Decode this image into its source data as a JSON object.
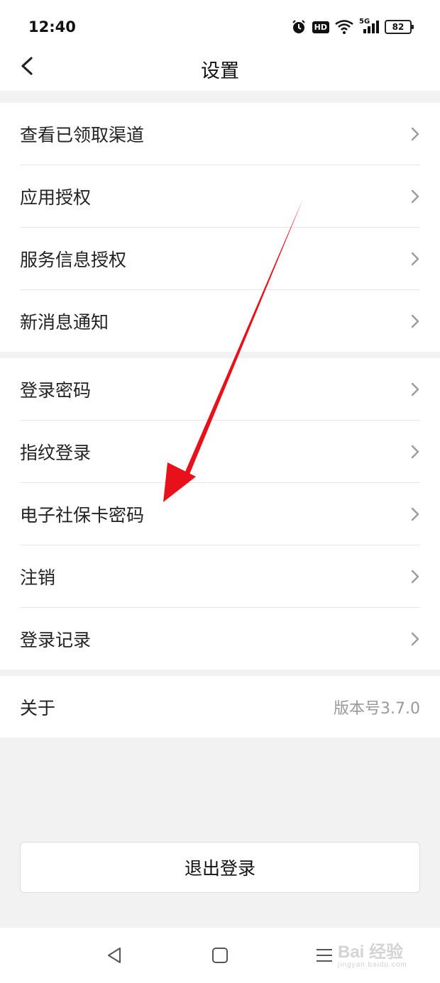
{
  "status": {
    "time": "12:40",
    "hd": "HD",
    "network": "5G",
    "battery": "82"
  },
  "header": {
    "title": "设置"
  },
  "group1": [
    {
      "label": "查看已领取渠道"
    },
    {
      "label": "应用授权"
    },
    {
      "label": "服务信息授权"
    },
    {
      "label": "新消息通知"
    }
  ],
  "group2": [
    {
      "label": "登录密码"
    },
    {
      "label": "指纹登录"
    },
    {
      "label": "电子社保卡密码"
    },
    {
      "label": "注销"
    },
    {
      "label": "登录记录"
    }
  ],
  "about": {
    "label": "关于",
    "version": "版本号3.7.0"
  },
  "logout_label": "退出登录",
  "watermark": {
    "brand": "Bai 经验",
    "url": "jingyan.baidu.com"
  },
  "colors": {
    "arrow": "#e8101a",
    "background": "#f2f2f2"
  }
}
